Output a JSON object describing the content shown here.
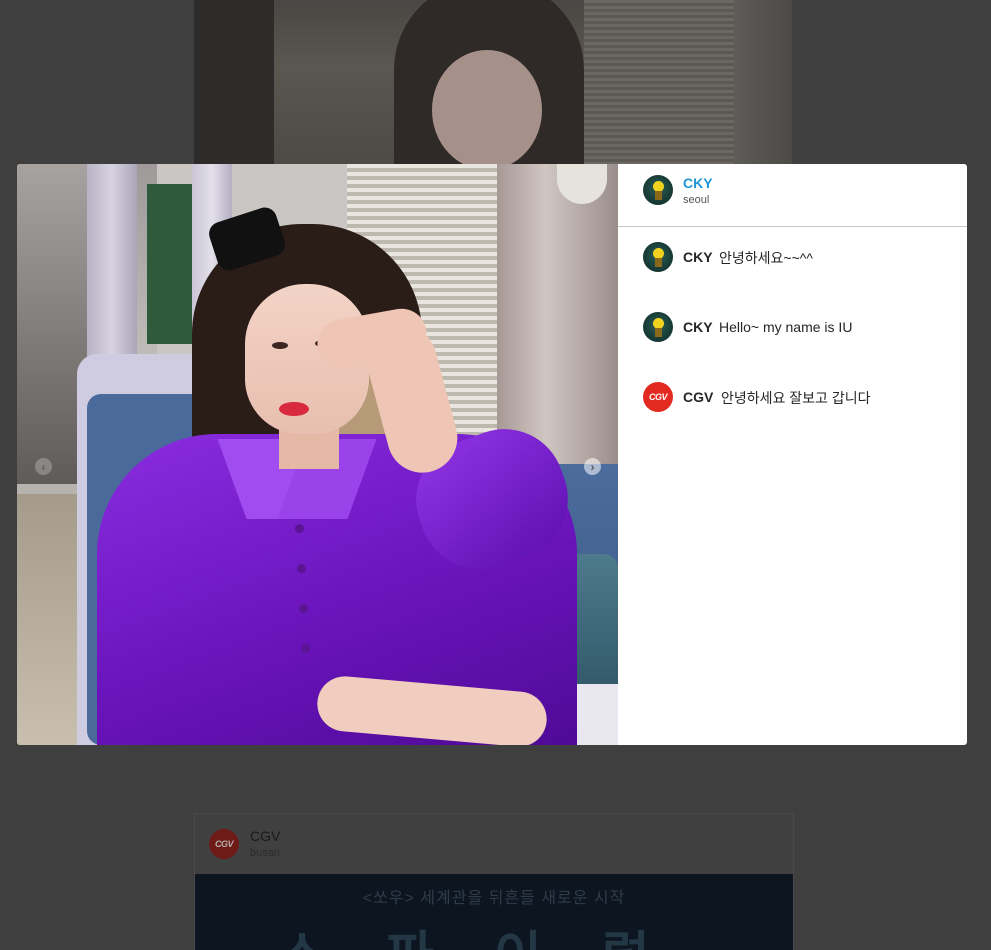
{
  "modal": {
    "post": {
      "author": "CKY",
      "location": "seoul"
    },
    "comments": [
      {
        "author": "CKY",
        "text": "안녕하세요~~^^",
        "avatar": "lightbulb-avatar"
      },
      {
        "author": "CKY",
        "text": "Hello~ my name is IU",
        "avatar": "lightbulb-avatar"
      },
      {
        "author": "CGV",
        "text": "안녕하세요 잘보고 갑니다",
        "avatar": "cgv-logo-avatar"
      }
    ],
    "nav": {
      "prev_icon": "chevron-left-icon",
      "next_icon": "chevron-right-icon"
    }
  },
  "feed": {
    "next_post": {
      "author": "CGV",
      "location": "busan",
      "avatar_label": "CGV",
      "media_caption": "<쏘우> 세계관을 뒤흔들 새로운 시작",
      "media_title": "스파이럴"
    }
  },
  "colors": {
    "overlay": "#3f3f3f",
    "username_accent": "#2196d6",
    "cgv_red": "#e32a20"
  }
}
